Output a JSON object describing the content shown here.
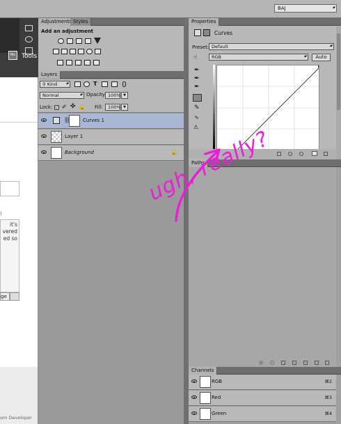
{
  "topbar": {
    "workspace": "BAJ"
  },
  "left_toolbar": {
    "ms_label": "Ms",
    "tools_label": "Tools"
  },
  "doc": {
    "text_lines": [
      "it's",
      "vered",
      "ed so"
    ],
    "button_label": "ge",
    "footer_text": "om Developer"
  },
  "adjustments": {
    "tabs": [
      "Adjustments",
      "Styles"
    ],
    "heading": "Add an adjustment"
  },
  "layers": {
    "tab": "Layers",
    "filter_kind": "Kind",
    "blend_mode": "Normal",
    "opacity_label": "Opacity:",
    "opacity_value": "100%",
    "lock_label": "Lock:",
    "fill_label": "Fill:",
    "fill_value": "100%",
    "items": [
      {
        "name": "Curves 1",
        "selected": true
      },
      {
        "name": "Layer 1",
        "selected": false
      },
      {
        "name": "Background",
        "selected": false,
        "locked": true
      }
    ]
  },
  "properties": {
    "tab": "Properties",
    "title": "Curves",
    "preset_label": "Preset:",
    "preset_value": "Default",
    "channel_value": "RGB",
    "auto_label": "Auto"
  },
  "paths": {
    "tab": "Paths"
  },
  "annotation": {
    "text": "ugh, really?",
    "color": "#ea1fd8"
  },
  "channels": {
    "tab": "Channels",
    "items": [
      {
        "name": "RGB",
        "shortcut": "⌘2"
      },
      {
        "name": "Red",
        "shortcut": "⌘3"
      },
      {
        "name": "Green",
        "shortcut": "⌘4"
      }
    ]
  }
}
